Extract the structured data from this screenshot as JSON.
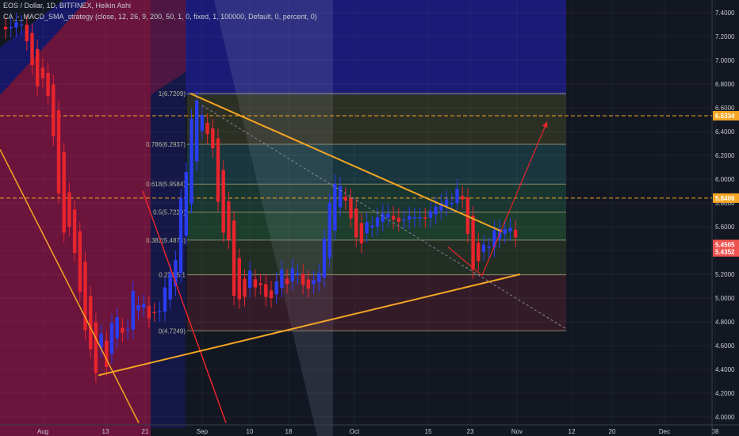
{
  "header": {
    "title": "EOS / Dollar, 1D, BITFINEX, Heikin Ashi",
    "strategy": "CA_-_MACD_SMA_strategy (close, 12, 26, 9, 200, 50, 1, 0, fixed, 1, 100000, Default, 0, percent, 0)"
  },
  "colors": {
    "background": "#131722",
    "bull": "#2a3df0",
    "bear": "#e8242c",
    "trendline": "#f5a623",
    "fib_line": "#8a8a6a",
    "price_label_orange": "#f5a623",
    "price_label_red": "#ef5350"
  },
  "chart_data": {
    "type": "candlestick",
    "title": "EOS / Dollar, 1D, BITFINEX, Heikin Ashi",
    "ylim": [
      3.95,
      7.45
    ],
    "yscale": "linear",
    "y_ticks": [
      "4.0000",
      "4.2000",
      "4.4000",
      "4.6000",
      "4.8000",
      "5.0000",
      "5.2000",
      "5.4000",
      "5.6000",
      "5.8000",
      "6.0000",
      "6.2000",
      "6.4000",
      "6.6000",
      "6.8000",
      "7.0000",
      "7.2000",
      "7.4000"
    ],
    "x_ticks": [
      "Aug",
      "13",
      "21",
      "Sep",
      "10",
      "18",
      "Oct",
      "15",
      "23",
      "Nov",
      "12",
      "20",
      "Dec",
      "08"
    ],
    "candles_close": [
      7.26,
      7.28,
      7.32,
      7.3,
      7.16,
      6.96,
      6.78,
      6.85,
      6.7,
      6.36,
      5.88,
      5.55,
      5.6,
      5.38,
      5.05,
      4.73,
      4.57,
      4.37,
      4.7,
      4.42,
      4.79,
      4.84,
      4.71,
      4.74,
      5.06,
      4.94,
      4.95,
      4.83,
      4.88,
      4.89,
      5.09,
      5.21,
      5.32,
      5.84,
      6.06,
      6.51,
      6.66,
      6.54,
      6.38,
      6.26,
      5.81,
      5.55,
      5.49,
      5.02,
      4.99,
      5.01,
      5.23,
      5.09,
      5.11,
      5.01,
      5,
      5.14,
      5.24,
      5.12,
      5.25,
      5.21,
      5.11,
      5.08,
      5.15,
      5.21,
      5.5,
      5.8,
      5.96,
      5.94,
      5.82,
      5.67,
      5.51,
      5.46,
      5.64,
      5.61,
      5.68,
      5.71,
      5.71,
      5.66,
      5.64,
      5.66,
      5.69,
      5.68,
      5.68,
      5.67,
      5.73,
      5.77,
      5.8,
      5.83,
      5.8,
      5.92,
      5.83,
      5.54,
      5.24,
      5.31,
      5.45,
      5.43,
      5.57,
      5.58,
      5.58,
      5.59,
      5.51
    ],
    "series": [
      {
        "name": "Fib 1",
        "label": "1(6.7209)",
        "value": 6.7209
      },
      {
        "name": "Fib 0.786",
        "label": "0.786(6.2937)",
        "value": 6.2937
      },
      {
        "name": "Fib 0.618",
        "label": "0.618(5.9584)",
        "value": 5.9584
      },
      {
        "name": "Fib 0.5",
        "label": "0.5(5.7229)",
        "value": 5.7229
      },
      {
        "name": "Fib 0.382",
        "label": "0.382(5.4874)",
        "value": 5.4874
      },
      {
        "name": "Fib 0.236",
        "label": "0.236(5.1",
        "value": 5.1959
      },
      {
        "name": "Fib 0",
        "label": "0(4.7249)",
        "value": 4.7249
      }
    ],
    "price_labels": [
      {
        "text": "6.5334",
        "value": 6.5334,
        "color": "#f5a623"
      },
      {
        "text": "5.8406",
        "value": 5.8406,
        "color": "#f5a623"
      },
      {
        "text": "5.4505",
        "value": 5.4505,
        "color": "#ef5350"
      },
      {
        "text": "5.4352",
        "value": 5.4352,
        "color": "#ef5350"
      }
    ],
    "horizontal_lines": [
      6.5334,
      5.8406
    ],
    "triangle": {
      "upper": [
        [
          6.72,
          6.72
        ],
        [
          5.56,
          5.56
        ]
      ],
      "lower": [
        [
          4.35,
          4.35
        ],
        [
          5.2,
          5.2
        ]
      ]
    },
    "projection_target": 6.5334,
    "projection_dip": 5.19
  }
}
